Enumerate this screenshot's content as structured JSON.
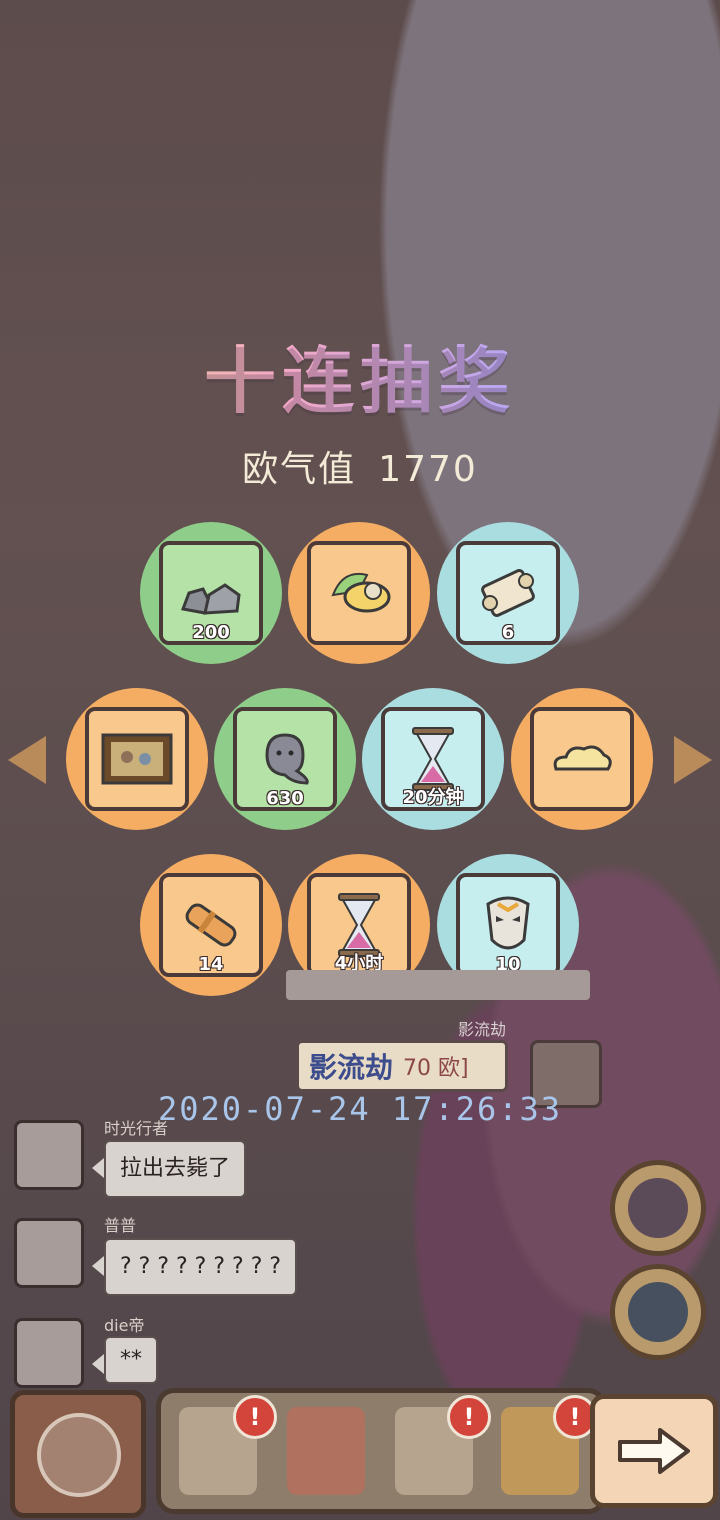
{
  "header": {
    "title": "十连抽奖",
    "luck_label": "欧气值",
    "luck_value": "1770"
  },
  "draw_results": [
    {
      "name": "stone-item",
      "qty": "200",
      "rarity": "green"
    },
    {
      "name": "winged-shoe-item",
      "qty": "",
      "rarity": "orange"
    },
    {
      "name": "scroll-item",
      "qty": "6",
      "rarity": "blue"
    },
    {
      "name": "painting-item",
      "qty": "",
      "rarity": "orange"
    },
    {
      "name": "blob-item",
      "qty": "630",
      "rarity": "green"
    },
    {
      "name": "hourglass-item",
      "qty": "20分钟",
      "rarity": "blue"
    },
    {
      "name": "cloud-item",
      "qty": "",
      "rarity": "orange"
    },
    {
      "name": "cannon-item",
      "qty": "14",
      "rarity": "orange"
    },
    {
      "name": "hourglass-item",
      "qty": "4小时",
      "rarity": "orange"
    },
    {
      "name": "mask-item",
      "qty": "10",
      "rarity": "blue"
    }
  ],
  "winner": {
    "top_label": "影流劫",
    "name": "影流劫",
    "ou_value": "70 欧]",
    "timestamp": "2020-07-24 17:26:33"
  },
  "chat": [
    {
      "user": "时光行者",
      "message": "拉出去毙了"
    },
    {
      "user": "普普",
      "message": "? ? ? ? ? ? ? ? ?"
    },
    {
      "user": "die帝",
      "message": "**"
    }
  ],
  "badges": {
    "alert": "!"
  },
  "colors": {
    "green": "#8fce8a",
    "orange": "#f4ad63",
    "blue": "#a9dde0"
  }
}
